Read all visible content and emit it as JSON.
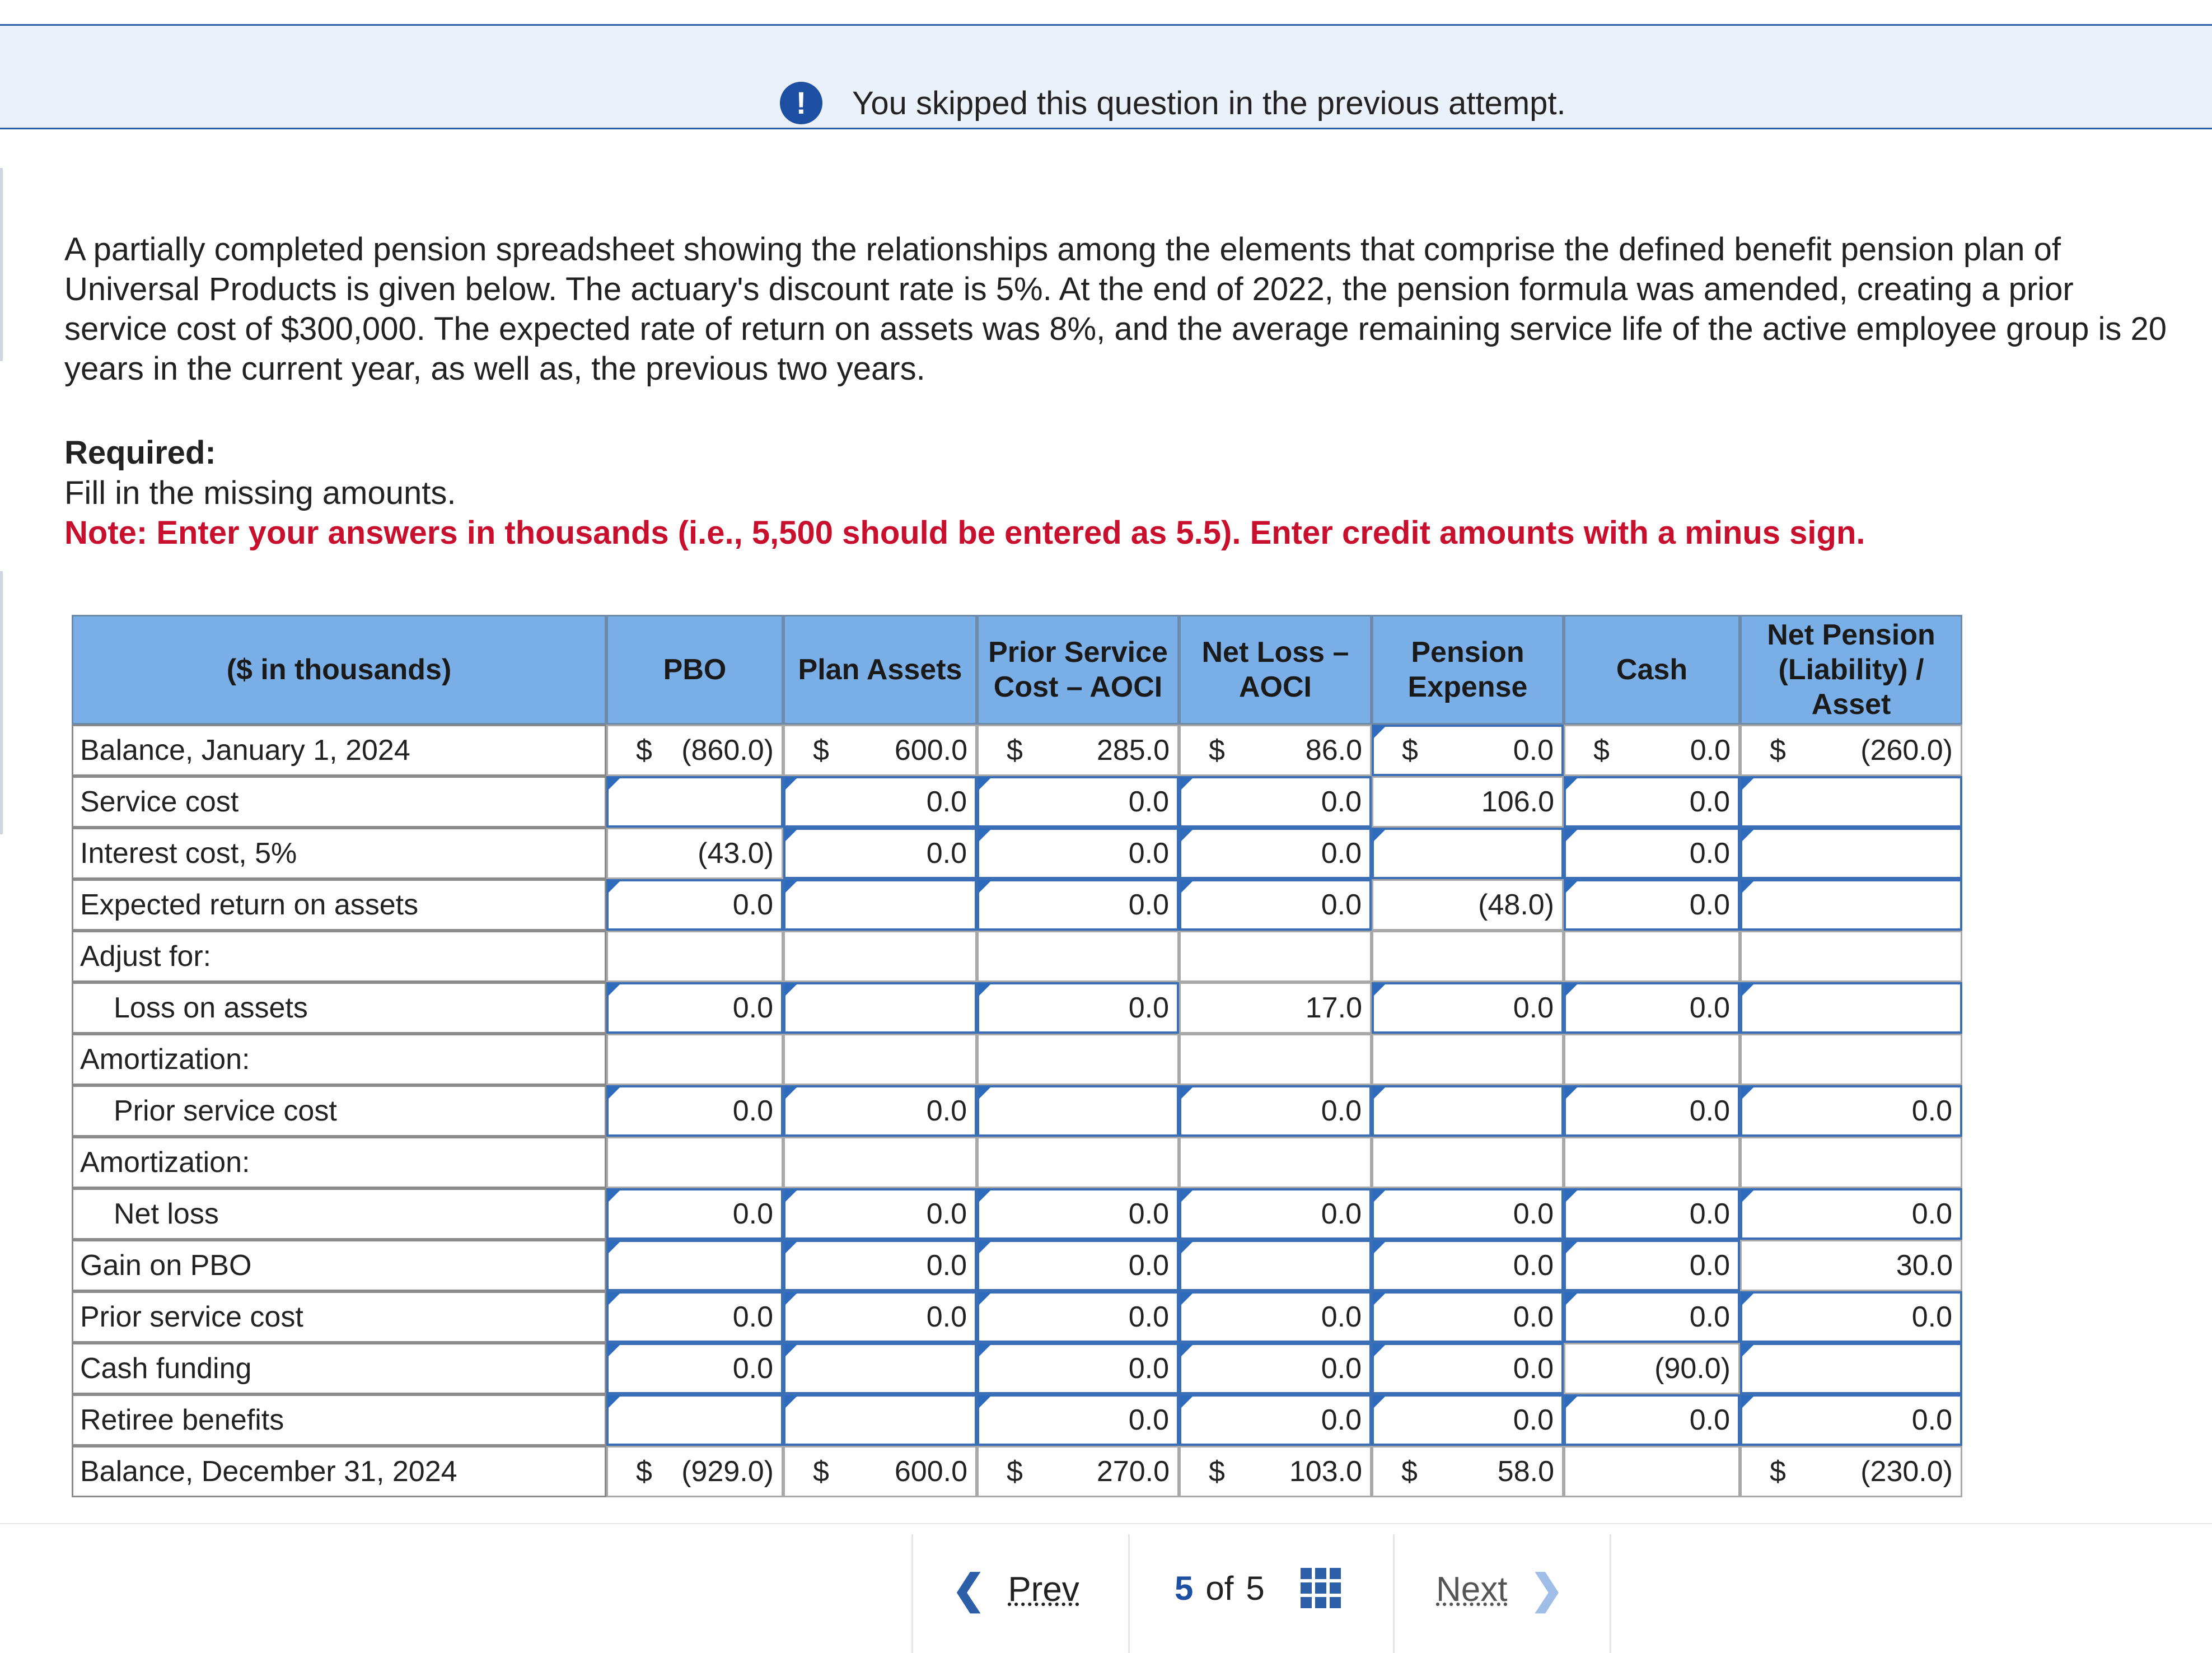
{
  "banner": {
    "text": "You skipped this question in the previous attempt."
  },
  "question": {
    "paragraph": "A partially completed pension spreadsheet showing the relationships among the elements that comprise the defined benefit pension plan of Universal Products is given below. The actuary's discount rate is 5%. At the end of 2022, the pension formula was amended, creating a prior service cost of $300,000. The expected rate of return on assets was 8%, and the average remaining service life of the active employee group is 20 years in the current year, as well as, the previous two years.",
    "required_title": "Required:",
    "required_body": "Fill in the missing amounts.",
    "note": "Note: Enter your answers in thousands (i.e., 5,500 should be entered as 5.5). Enter credit amounts with a minus sign."
  },
  "table": {
    "headers": [
      "($ in thousands)",
      "PBO",
      "Plan Assets",
      "Prior Service Cost – AOCI",
      "Net Loss – AOCI",
      "Pension Expense",
      "Cash",
      "Net Pension (Liability) / Asset"
    ],
    "currency_symbol": "$",
    "rows": [
      {
        "label": "Balance, January 1, 2024",
        "indent": false,
        "dollar": true,
        "cells": [
          "(860.0)",
          "600.0",
          "285.0",
          "86.0",
          "0.0",
          "0.0",
          "(260.0)"
        ],
        "inputs": [
          false,
          false,
          false,
          false,
          true,
          false,
          false
        ]
      },
      {
        "label": "Service cost",
        "indent": false,
        "dollar": false,
        "cells": [
          "",
          "0.0",
          "0.0",
          "0.0",
          "106.0",
          "0.0",
          ""
        ],
        "inputs": [
          true,
          true,
          true,
          true,
          false,
          true,
          true
        ]
      },
      {
        "label": "Interest cost, 5%",
        "indent": false,
        "dollar": false,
        "cells": [
          "(43.0)",
          "0.0",
          "0.0",
          "0.0",
          "",
          "0.0",
          ""
        ],
        "inputs": [
          false,
          true,
          true,
          true,
          true,
          true,
          true
        ]
      },
      {
        "label": "Expected return on assets",
        "indent": false,
        "dollar": false,
        "cells": [
          "0.0",
          "",
          "0.0",
          "0.0",
          "(48.0)",
          "0.0",
          ""
        ],
        "inputs": [
          true,
          true,
          true,
          true,
          false,
          true,
          true
        ]
      },
      {
        "label": "Adjust for:",
        "indent": false,
        "dollar": false,
        "cells": [
          "",
          "",
          "",
          "",
          "",
          "",
          ""
        ],
        "inputs": [
          false,
          false,
          false,
          false,
          false,
          false,
          false
        ]
      },
      {
        "label": "Loss on assets",
        "indent": true,
        "dollar": false,
        "cells": [
          "0.0",
          "",
          "0.0",
          "17.0",
          "0.0",
          "0.0",
          ""
        ],
        "inputs": [
          true,
          true,
          true,
          false,
          true,
          true,
          true
        ]
      },
      {
        "label": "Amortization:",
        "indent": false,
        "dollar": false,
        "cells": [
          "",
          "",
          "",
          "",
          "",
          "",
          ""
        ],
        "inputs": [
          false,
          false,
          false,
          false,
          false,
          false,
          false
        ]
      },
      {
        "label": "Prior service cost",
        "indent": true,
        "dollar": false,
        "cells": [
          "0.0",
          "0.0",
          "",
          "0.0",
          "",
          "0.0",
          "0.0"
        ],
        "inputs": [
          true,
          true,
          true,
          true,
          true,
          true,
          true
        ]
      },
      {
        "label": "Amortization:",
        "indent": false,
        "dollar": false,
        "cells": [
          "",
          "",
          "",
          "",
          "",
          "",
          ""
        ],
        "inputs": [
          false,
          false,
          false,
          false,
          false,
          false,
          false
        ]
      },
      {
        "label": "Net loss",
        "indent": true,
        "dollar": false,
        "cells": [
          "0.0",
          "0.0",
          "0.0",
          "0.0",
          "0.0",
          "0.0",
          "0.0"
        ],
        "inputs": [
          true,
          true,
          true,
          true,
          true,
          true,
          true
        ]
      },
      {
        "label": "Gain on PBO",
        "indent": false,
        "dollar": false,
        "cells": [
          "",
          "0.0",
          "0.0",
          "",
          "0.0",
          "0.0",
          "30.0"
        ],
        "inputs": [
          true,
          true,
          true,
          true,
          true,
          true,
          false
        ]
      },
      {
        "label": "Prior service cost",
        "indent": false,
        "dollar": false,
        "cells": [
          "0.0",
          "0.0",
          "0.0",
          "0.0",
          "0.0",
          "0.0",
          "0.0"
        ],
        "inputs": [
          true,
          true,
          true,
          true,
          true,
          true,
          true
        ]
      },
      {
        "label": "Cash funding",
        "indent": false,
        "dollar": false,
        "cells": [
          "0.0",
          "",
          "0.0",
          "0.0",
          "0.0",
          "(90.0)",
          ""
        ],
        "inputs": [
          true,
          true,
          true,
          true,
          true,
          false,
          true
        ]
      },
      {
        "label": "Retiree benefits",
        "indent": false,
        "dollar": false,
        "cells": [
          "",
          "",
          "0.0",
          "0.0",
          "0.0",
          "0.0",
          "0.0"
        ],
        "inputs": [
          true,
          true,
          true,
          true,
          true,
          true,
          true
        ]
      },
      {
        "label": "Balance, December 31, 2024",
        "indent": false,
        "dollar": true,
        "cells": [
          "(929.0)",
          "600.0",
          "270.0",
          "103.0",
          "58.0",
          "",
          "(230.0)"
        ],
        "inputs": [
          false,
          false,
          false,
          false,
          false,
          false,
          false
        ],
        "dollar_mask": [
          true,
          true,
          true,
          true,
          true,
          false,
          true
        ]
      }
    ]
  },
  "nav": {
    "prev": "Prev",
    "current": "5",
    "of": "of",
    "total": "5",
    "next": "Next"
  }
}
